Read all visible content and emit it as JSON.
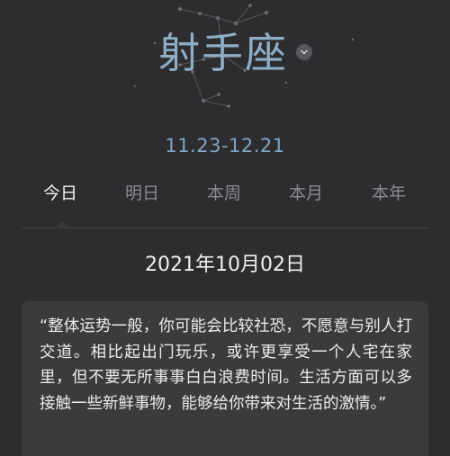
{
  "sign": {
    "name": "射手座",
    "dropdown_icon": "chevron-down-icon",
    "date_range": "11.23-12.21"
  },
  "tabs": [
    {
      "label": "今日",
      "active": true
    },
    {
      "label": "明日",
      "active": false
    },
    {
      "label": "本周",
      "active": false
    },
    {
      "label": "本月",
      "active": false
    },
    {
      "label": "本年",
      "active": false
    }
  ],
  "date": "2021年10月02日",
  "fortune": {
    "text": "“整体运势一般，你可能会比较社恐，不愿意与别人打交道。相比起出门玩乐，或许更享受一个人宅在家里，但不要无所事事白白浪费时间。生活方面可以多接触一些新鲜事物，能够给你带来对生活的激情。”"
  },
  "colors": {
    "background": "#2d2d2f",
    "accent": "#8eaec8",
    "card": "#3b3b3e"
  }
}
